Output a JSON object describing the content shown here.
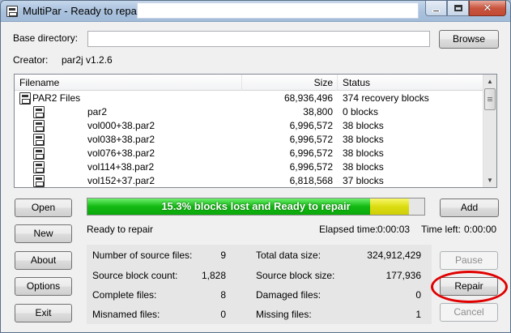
{
  "window": {
    "title": "MultiPar - Ready to repair",
    "caption": {
      "minimize_icon": "minimize-icon",
      "maximize_icon": "maximize-icon",
      "close_glyph": "✕"
    }
  },
  "base_directory": {
    "label": "Base directory:",
    "value": "",
    "browse_label": "Browse"
  },
  "creator": {
    "label": "Creator:",
    "value": "par2j v1.2.6"
  },
  "file_list": {
    "columns": {
      "filename": "Filename",
      "size": "Size",
      "status": "Status"
    },
    "rows": [
      {
        "name": "PAR2 Files",
        "size": "68,936,496",
        "status": "374 recovery blocks",
        "group": true
      },
      {
        "name": "par2",
        "size": "38,800",
        "status": "0 blocks",
        "group": false
      },
      {
        "name": "vol000+38.par2",
        "size": "6,996,572",
        "status": "38 blocks",
        "group": false
      },
      {
        "name": "vol038+38.par2",
        "size": "6,996,572",
        "status": "38 blocks",
        "group": false
      },
      {
        "name": "vol076+38.par2",
        "size": "6,996,572",
        "status": "38 blocks",
        "group": false
      },
      {
        "name": "vol114+38.par2",
        "size": "6,996,572",
        "status": "38 blocks",
        "group": false
      },
      {
        "name": "vol152+37.par2",
        "size": "6,818,568",
        "status": "37 blocks",
        "group": false
      }
    ]
  },
  "progress": {
    "text": "15.3% blocks lost and Ready to repair",
    "green_fraction": 0.845,
    "yellow_fraction": 0.155,
    "colors": {
      "green": "#13b913",
      "yellow": "#dcdc13"
    }
  },
  "status_line": {
    "message": "Ready to repair",
    "elapsed_label": "Elapsed time:",
    "elapsed_value": "0:00:03",
    "left_label": "Time left:",
    "left_value": "0:00:00"
  },
  "stats": {
    "source_files_label": "Number of source files:",
    "source_files": "9",
    "source_blocks_label": "Source block count:",
    "source_blocks": "1,828",
    "complete_label": "Complete files:",
    "complete": "8",
    "misnamed_label": "Misnamed files:",
    "misnamed": "0",
    "total_size_label": "Total data size:",
    "total_size": "324,912,429",
    "block_size_label": "Source block size:",
    "block_size": "177,936",
    "damaged_label": "Damaged files:",
    "damaged": "0",
    "missing_label": "Missing files:",
    "missing": "1"
  },
  "buttons": {
    "open": "Open",
    "new": "New",
    "about": "About",
    "options": "Options",
    "exit": "Exit",
    "add": "Add",
    "pause": "Pause",
    "repair": "Repair",
    "cancel": "Cancel"
  },
  "annotation_color": "#e00000"
}
